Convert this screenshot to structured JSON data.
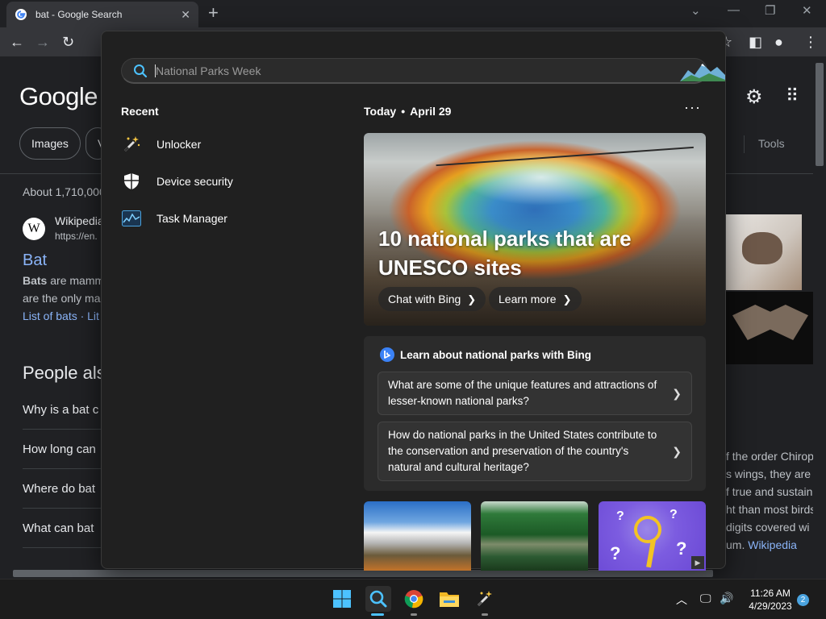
{
  "browser": {
    "tab_title": "bat - Google Search",
    "tab_close": "✕",
    "new_tab": "+"
  },
  "google": {
    "logo": "Google",
    "chip_images": "Images",
    "chip_partial": "V",
    "tools": "Tools",
    "result_count": "About 1,710,000",
    "wiki_source": "Wikipedia",
    "wiki_url": "https://en.",
    "result_title": "Bat",
    "snippet_line1_bold": "Bats",
    "snippet_line1": " are mamm",
    "snippet_line2": "are the only mai",
    "links": "List of bats · Lit",
    "paa_heading": "People als",
    "paa_items": [
      "Why is a bat c",
      "How long can",
      "Where do bat",
      "What can bat"
    ],
    "right_snippet": [
      "f the order Chirop",
      "s wings, they are t",
      "f true and sustain",
      "ht than most birds",
      "digits covered wi",
      "um."
    ],
    "right_link": "Wikipedia"
  },
  "search": {
    "placeholder": "National Parks Week",
    "recent_heading": "Recent",
    "recent_items": [
      {
        "label": "Unlocker",
        "icon": "magic-wand-icon"
      },
      {
        "label": "Device security",
        "icon": "shield-icon"
      },
      {
        "label": "Task Manager",
        "icon": "task-manager-icon"
      }
    ],
    "today_label": "Today",
    "today_date": "April 29",
    "more": "···",
    "hero": {
      "title": "10 national parks that are UNESCO sites",
      "btn_chat": "Chat with Bing",
      "btn_learn": "Learn more"
    },
    "bing_card": {
      "heading": "Learn about national parks with Bing",
      "q1": "What are some of the unique features and attractions of lesser-known national parks?",
      "q2": "How do national parks in the United States contribute to the conservation and preservation of the country's natural and cultural heritage?"
    }
  },
  "taskbar": {
    "time": "11:26 AM",
    "date": "4/29/2023",
    "notifications": "2"
  },
  "colors": {
    "accent": "#4aa3df",
    "link": "#8ab4f8"
  }
}
